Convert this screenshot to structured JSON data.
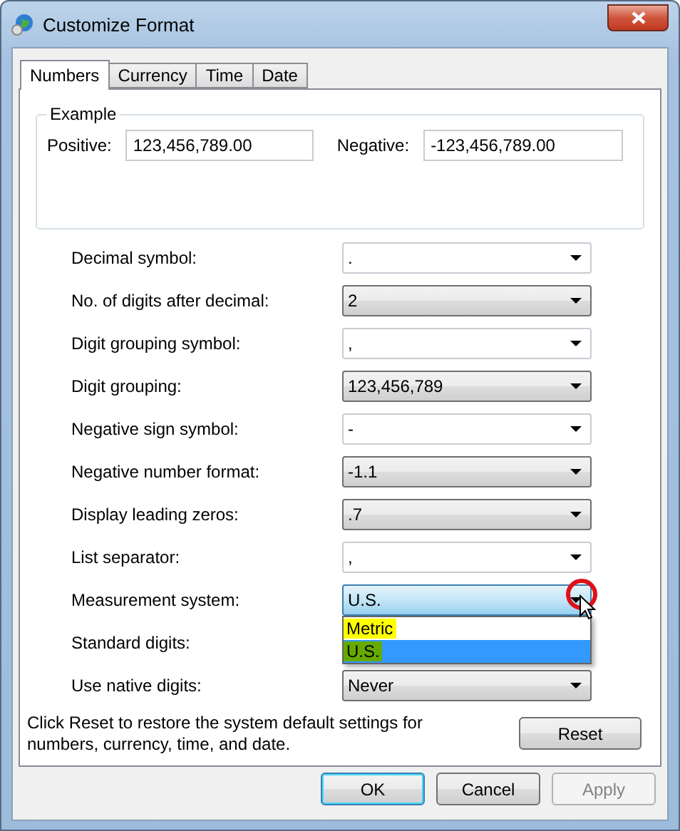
{
  "window": {
    "title": "Customize Format"
  },
  "tabs": [
    {
      "label": "Numbers",
      "selected": true
    },
    {
      "label": "Currency",
      "selected": false
    },
    {
      "label": "Time",
      "selected": false
    },
    {
      "label": "Date",
      "selected": false
    }
  ],
  "example": {
    "title": "Example",
    "positive_label": "Positive:",
    "positive_value": "123,456,789.00",
    "negative_label": "Negative:",
    "negative_value": "-123,456,789.00"
  },
  "settings": [
    {
      "label": "Decimal symbol:",
      "value": ".",
      "kind": "edit"
    },
    {
      "label": "No. of digits after decimal:",
      "value": "2",
      "kind": "list"
    },
    {
      "label": "Digit grouping symbol:",
      "value": ",",
      "kind": "edit"
    },
    {
      "label": "Digit grouping:",
      "value": "123,456,789",
      "kind": "list"
    },
    {
      "label": "Negative sign symbol:",
      "value": "-",
      "kind": "edit"
    },
    {
      "label": "Negative number format:",
      "value": "-1.1",
      "kind": "list"
    },
    {
      "label": "Display leading zeros:",
      "value": ".7",
      "kind": "list"
    },
    {
      "label": "List separator:",
      "value": ",",
      "kind": "edit"
    },
    {
      "label": "Measurement system:",
      "value": "U.S.",
      "kind": "list",
      "open": true,
      "options": [
        {
          "label": "Metric",
          "selected": false,
          "color": "#ffff00"
        },
        {
          "label": "U.S.",
          "selected": true,
          "color": "#66aa00"
        }
      ]
    },
    {
      "label": "Standard digits:"
    },
    {
      "label": "Use native digits:",
      "value": "Never",
      "kind": "list"
    }
  ],
  "reset_note": "Click Reset to restore the system default settings for numbers, currency, time, and date.",
  "reset_button": "Reset",
  "buttons": [
    {
      "label": "OK",
      "kind": "default",
      "disabled": false
    },
    {
      "label": "Cancel",
      "kind": "normal",
      "disabled": false
    },
    {
      "label": "Apply",
      "kind": "normal",
      "disabled": true
    }
  ]
}
